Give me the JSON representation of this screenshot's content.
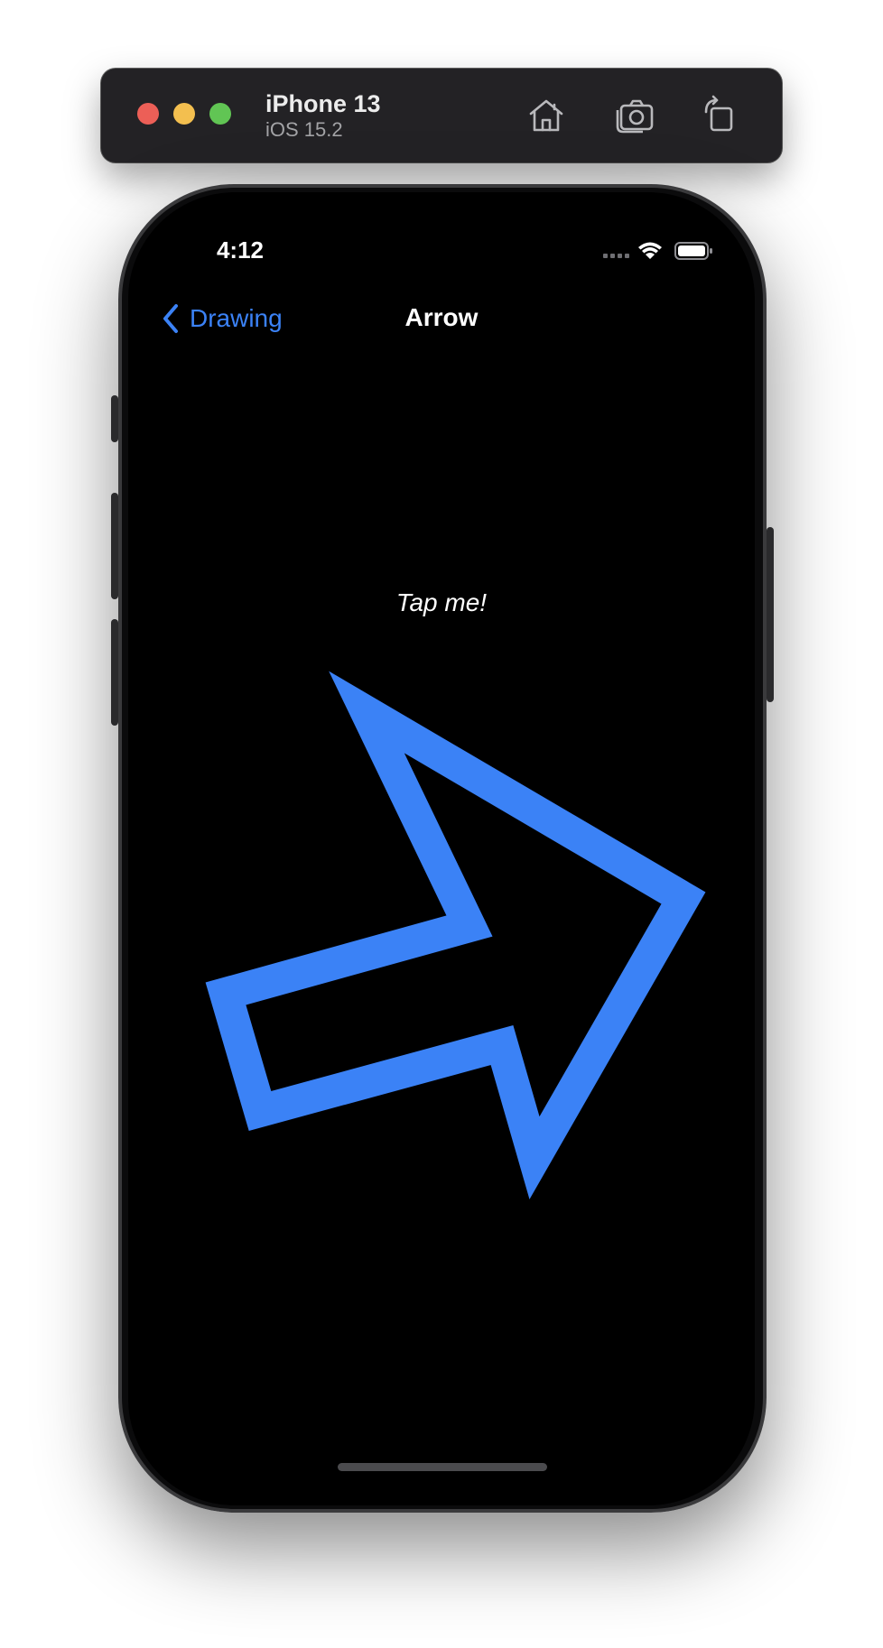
{
  "simulator": {
    "device_name": "iPhone 13",
    "os_version": "iOS 15.2",
    "toolbar_icons": [
      "home-icon",
      "screenshot-icon",
      "rotate-icon"
    ]
  },
  "status_bar": {
    "time": "4:12"
  },
  "nav": {
    "back_label": "Drawing",
    "title": "Arrow"
  },
  "content": {
    "tap_label": "Tap me!"
  },
  "colors": {
    "accent": "#3b82f6",
    "screen_background": "#000000",
    "text": "#ffffff"
  }
}
